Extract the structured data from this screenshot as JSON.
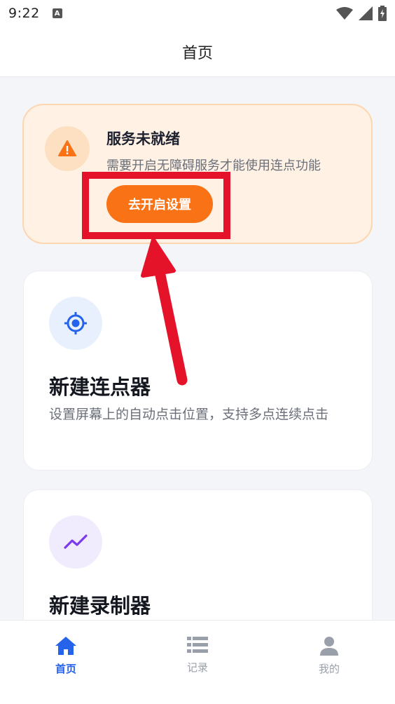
{
  "status_bar": {
    "time": "9:22",
    "notification_icon": "A",
    "icons": [
      "wifi-icon",
      "signal-icon",
      "battery-icon"
    ]
  },
  "header": {
    "title": "首页"
  },
  "warning_card": {
    "title": "服务未就绪",
    "description": "需要开启无障碍服务才能使用连点功能",
    "button_label": "去开启设置",
    "icon": "warning-icon",
    "accent_color": "#f97316"
  },
  "cards": [
    {
      "title": "新建连点器",
      "description": "设置屏幕上的自动点击位置，支持多点连续点击",
      "icon": "target-icon",
      "icon_color": "#2563eb"
    },
    {
      "title": "新建录制器",
      "icon": "trend-line-icon",
      "icon_color": "#7c3aed"
    }
  ],
  "annotation": {
    "highlight_color": "#e5132a"
  },
  "bottom_nav": {
    "items": [
      {
        "label": "首页",
        "icon": "home-icon",
        "active": true
      },
      {
        "label": "记录",
        "icon": "list-icon",
        "active": false
      },
      {
        "label": "我的",
        "icon": "person-icon",
        "active": false
      }
    ],
    "active_color": "#2563eb",
    "inactive_color": "#9aa0aa"
  }
}
